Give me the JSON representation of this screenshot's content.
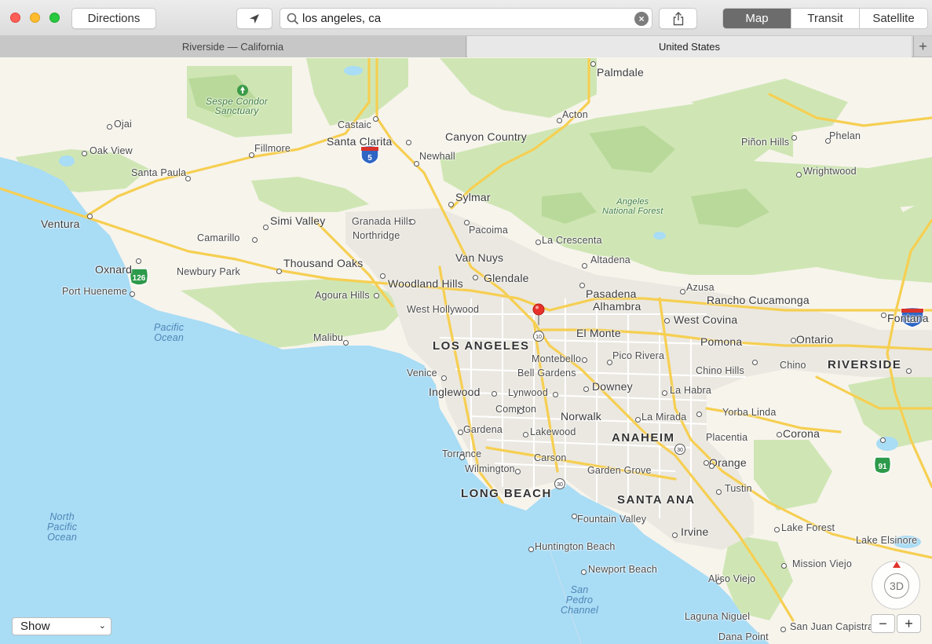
{
  "toolbar": {
    "directions_label": "Directions",
    "search_value": "los angeles, ca",
    "view_modes": [
      "Map",
      "Transit",
      "Satellite"
    ],
    "selected_mode": "Map"
  },
  "tabs": [
    "Riverside — California",
    "United States"
  ],
  "tab_add": "+",
  "show_select": "Show",
  "compass_label": "3D",
  "zoom": {
    "out": "−",
    "in": "+"
  },
  "colors": {
    "land": "#f7f4ec",
    "water": "#a9dcf5",
    "park": "#cfe6b4",
    "highway": "#f6cf52",
    "pin": "#e8302a"
  },
  "map": {
    "major_cities": [
      "LOS ANGELES",
      "LONG BEACH",
      "ANAHEIM",
      "SANTA ANA",
      "RIVERSIDE"
    ],
    "cities": [
      "Palmdale",
      "Acton",
      "Castaic",
      "Santa Clarita",
      "Canyon Country",
      "Newhall",
      "Piñon Hills",
      "Phelan",
      "Wrightwood",
      "Ojai",
      "Oak View",
      "Fillmore",
      "Santa Paula",
      "Sylmar",
      "Ventura",
      "Simi Valley",
      "Granada Hills",
      "Northridge",
      "Pacoima",
      "La Crescenta",
      "Camarillo",
      "Van Nuys",
      "Altadena",
      "Oxnard",
      "Thousand Oaks",
      "Newbury Park",
      "Glendale",
      "Woodland Hills",
      "Azusa",
      "Port Hueneme",
      "Agoura Hills",
      "Pasadena",
      "Alhambra",
      "Rancho Cucamonga",
      "West Hollywood",
      "West Covina",
      "Fontana",
      "Malibu",
      "El Monte",
      "Pomona",
      "Ontario",
      "Montebello",
      "Pico Rivera",
      "Venice",
      "Bell Gardens",
      "Chino Hills",
      "Chino",
      "Inglewood",
      "Lynwood",
      "Downey",
      "La Habra",
      "Compton",
      "Norwalk",
      "La Mirada",
      "Yorba Linda",
      "Gardena",
      "Lakewood",
      "Placentia",
      "Corona",
      "Torrance",
      "Carson",
      "Orange",
      "Wilmington",
      "Garden Grove",
      "Tustin",
      "Fountain Valley",
      "Irvine",
      "Lake Forest",
      "Lake Elsinore",
      "Huntington Beach",
      "Mission Viejo",
      "Newport Beach",
      "Aliso Viejo",
      "Laguna Niguel",
      "San Juan Capistrano",
      "Dana Point"
    ],
    "water_labels": [
      "Pacific Ocean",
      "North Pacific Ocean",
      "San Pedro Channel"
    ],
    "park_labels": [
      "Sespe Condor Sanctuary",
      "Angeles National Forest"
    ],
    "highway_shields": [
      "5",
      "126",
      "215",
      "91"
    ],
    "small_shields": [
      "10",
      "30"
    ]
  }
}
